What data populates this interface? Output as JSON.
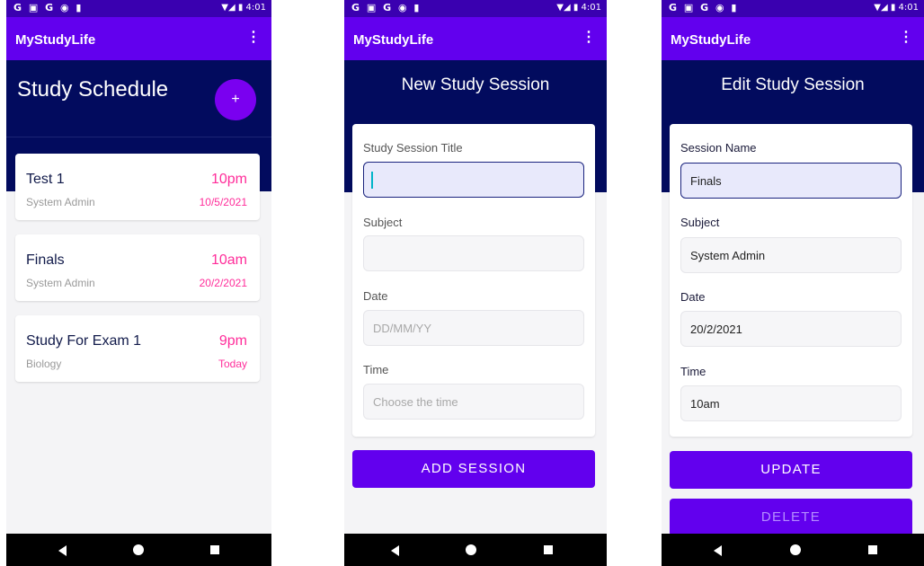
{
  "status": {
    "icons": "G ▣ G ◉ ▮",
    "time": "▼◢ ▮ 4:01"
  },
  "app_title": "MyStudyLife",
  "overflow_icon": "⋮",
  "schedule": {
    "title": "Study Schedule",
    "fab": "+",
    "sessions": [
      {
        "title": "Test 1",
        "subject": "System Admin",
        "time": "10pm",
        "date": "10/5/2021"
      },
      {
        "title": "Finals",
        "subject": "System Admin",
        "time": "10am",
        "date": "20/2/2021"
      },
      {
        "title": "Study For Exam 1",
        "subject": "Biology",
        "time": "9pm",
        "date": "Today"
      }
    ]
  },
  "new_session": {
    "title": "New Study Session",
    "fields": {
      "title_label": "Study Session Title",
      "subject_label": "Subject",
      "date_label": "Date",
      "date_placeholder": "DD/MM/YY",
      "time_label": "Time",
      "time_placeholder": "Choose the time"
    },
    "add_button": "ADD SESSION"
  },
  "edit_session": {
    "title": "Edit Study Session",
    "fields": {
      "name_label": "Session Name",
      "name_value": "Finals",
      "subject_label": "Subject",
      "subject_value": "System Admin",
      "date_label": "Date",
      "date_value": "20/2/2021",
      "time_label": "Time",
      "time_value": "10am"
    },
    "update_button": "UPDATE",
    "delete_button": "DELETE"
  },
  "colors": {
    "primary": "#6200ee",
    "status": "#3a00b0",
    "header": "#020b5e",
    "accent": "#ff2d9a"
  }
}
